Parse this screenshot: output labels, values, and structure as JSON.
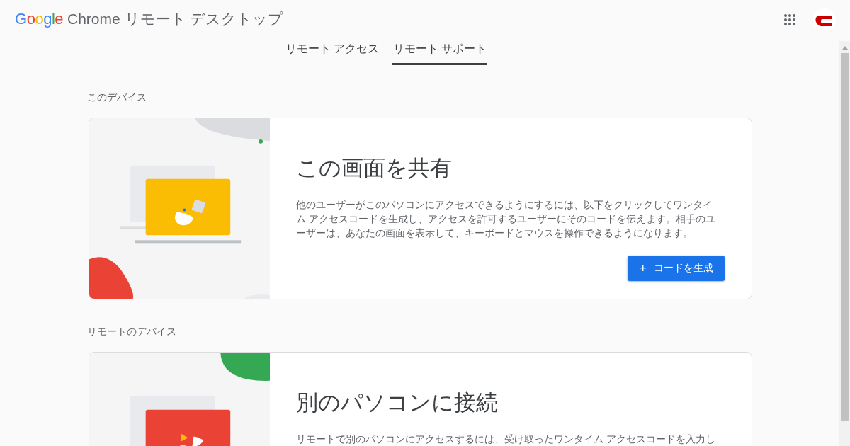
{
  "header": {
    "logo": "Google",
    "title": "Chrome リモート デスクトップ"
  },
  "tabs": [
    {
      "label": "リモート アクセス",
      "selected": false
    },
    {
      "label": "リモート サポート",
      "selected": true
    }
  ],
  "sections": [
    {
      "heading": "このデバイス",
      "card": {
        "kind": "share",
        "title": "この画面を共有",
        "body": "他のユーザーがこのパソコンにアクセスできるようにするには、以下をクリックしてワンタイム アクセスコードを生成し、アクセスを許可するユーザーにそのコードを伝えます。相手のユーザーは、あなたの画面を表示して、キーボードとマウスを操作できるようになります。",
        "button": {
          "icon": "+",
          "label": "コードを生成"
        }
      }
    },
    {
      "heading": "リモートのデバイス",
      "card": {
        "kind": "connect",
        "title": "別のパソコンに接続",
        "body": "リモートで別のパソコンにアクセスするには、受け取ったワンタイム アクセスコードを入力し"
      }
    }
  ]
}
